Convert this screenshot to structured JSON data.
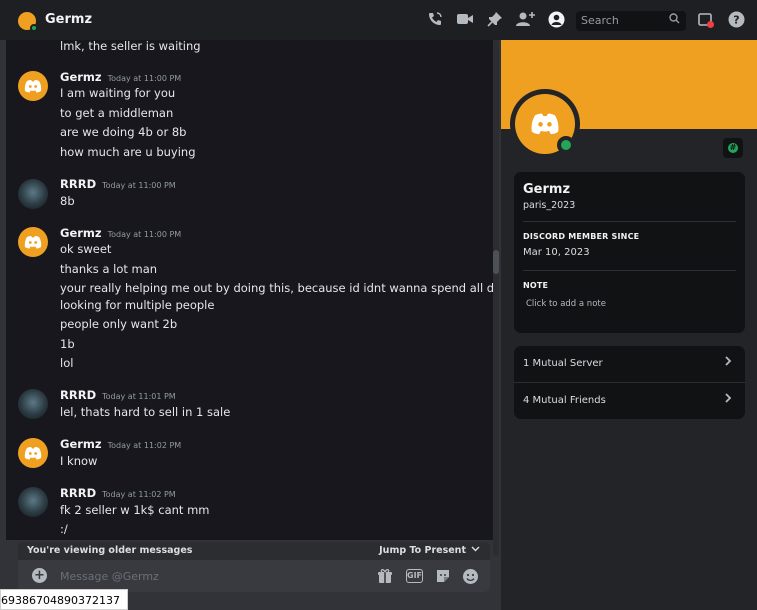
{
  "header": {
    "title": "Germz",
    "search_placeholder": "Search",
    "icons": [
      "start-voice-call-icon",
      "start-video-call-icon",
      "pinned-messages-icon",
      "add-friends-icon",
      "user-profile-icon",
      "search-icon",
      "inbox-icon",
      "help-icon"
    ]
  },
  "messages": [
    {
      "type": "continuation",
      "lines": [
        "lmk, the seller is waiting"
      ]
    },
    {
      "author": "Germz",
      "timestamp": "Today at 11:00 PM",
      "avatar": "discord-logo",
      "lines": [
        "I am waiting for you",
        "to get a middleman",
        "are we doing 4b or 8b",
        "how much are u buying"
      ]
    },
    {
      "author": "RRRD",
      "timestamp": "Today at 11:00 PM",
      "avatar": "rrrd-avatar",
      "lines": [
        "8b"
      ]
    },
    {
      "author": "Germz",
      "timestamp": "Today at 11:00 PM",
      "avatar": "discord-logo",
      "lines": [
        "ok sweet",
        "thanks a lot man",
        "your really helping me out by doing this, because id idnt wanna spend all day",
        "looking for multiple people",
        "people only want 2b",
        "1b",
        "lol"
      ]
    },
    {
      "author": "RRRD",
      "timestamp": "Today at 11:01 PM",
      "avatar": "rrrd-avatar",
      "lines": [
        "lel, thats hard to sell in 1 sale"
      ]
    },
    {
      "author": "Germz",
      "timestamp": "Today at 11:02 PM",
      "avatar": "discord-logo",
      "lines": [
        "I know"
      ]
    },
    {
      "author": "RRRD",
      "timestamp": "Today at 11:02 PM",
      "avatar": "rrrd-avatar",
      "lines": [
        "fk 2 seller w 1k$ cant mm",
        ":/"
      ]
    }
  ],
  "older_bar": {
    "label": "You're viewing older messages",
    "jump": "Jump To Present"
  },
  "composer": {
    "placeholder": "Message @Germz",
    "gif_label": "GIF"
  },
  "id_strip": "69386704890372137",
  "profile": {
    "display_name": "Germz",
    "username": "paris_2023",
    "member_since_title": "DISCORD MEMBER SINCE",
    "member_since": "Mar 10, 2023",
    "note_title": "NOTE",
    "note_placeholder": "Click to add a note",
    "mutual_server": "1 Mutual Server",
    "mutual_friends": "4 Mutual Friends",
    "status": "online"
  },
  "colors": {
    "brand_orange": "#f0a020",
    "online_green": "#23a55a",
    "chat_bg": "#17171d",
    "panel_bg": "#232428"
  }
}
